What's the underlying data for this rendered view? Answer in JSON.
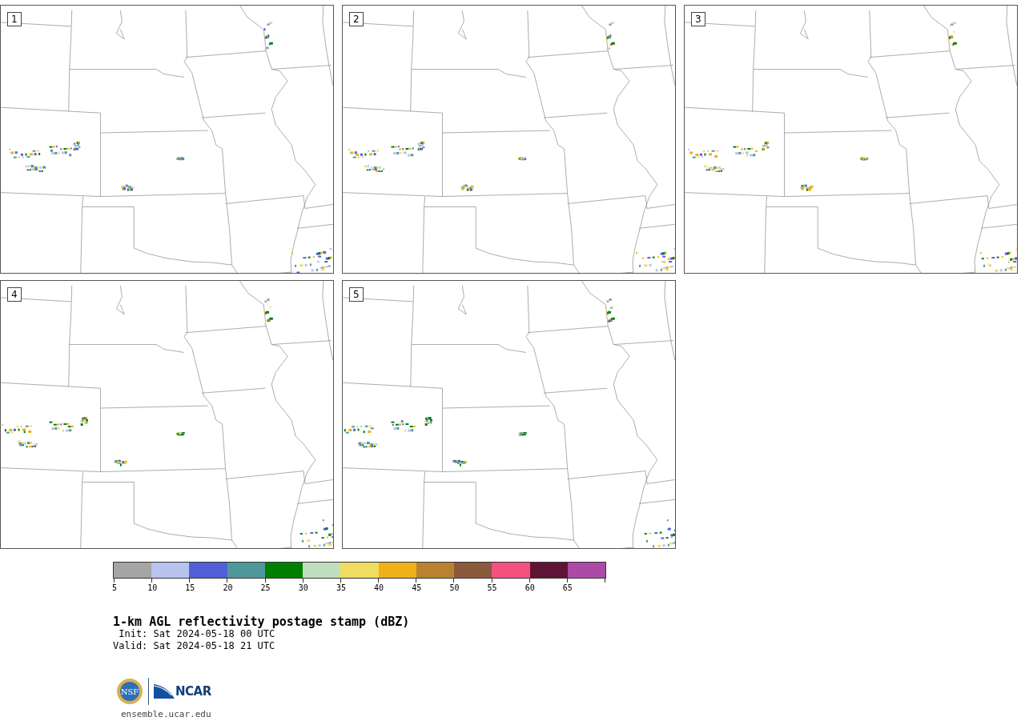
{
  "panels": [
    {
      "label": "1"
    },
    {
      "label": "2"
    },
    {
      "label": "3"
    },
    {
      "label": "4"
    },
    {
      "label": "5"
    }
  ],
  "colorbar": {
    "bins": [
      {
        "color": "#a5a5a5"
      },
      {
        "color": "#b8c3ee"
      },
      {
        "color": "#5060d8"
      },
      {
        "color": "#50979b"
      },
      {
        "color": "#008000"
      },
      {
        "color": "#bfdfbf"
      },
      {
        "color": "#f0dc60"
      },
      {
        "color": "#f0b018"
      },
      {
        "color": "#b88230"
      },
      {
        "color": "#8b5a3c"
      },
      {
        "color": "#f55080"
      },
      {
        "color": "#5e1535"
      },
      {
        "color": "#ad4aa8"
      }
    ],
    "ticks": [
      "5",
      "10",
      "15",
      "20",
      "25",
      "30",
      "35",
      "40",
      "45",
      "50",
      "55",
      "60",
      "65"
    ]
  },
  "title": "1-km AGL reflectivity postage stamp (dBZ)",
  "init": " Init: Sat 2024-05-18 00 UTC",
  "valid": "Valid: Sat 2024-05-18 21 UTC",
  "logos": {
    "nsf": "NSF",
    "ncar": "NCAR"
  },
  "url": "ensemble.ucar.edu"
}
